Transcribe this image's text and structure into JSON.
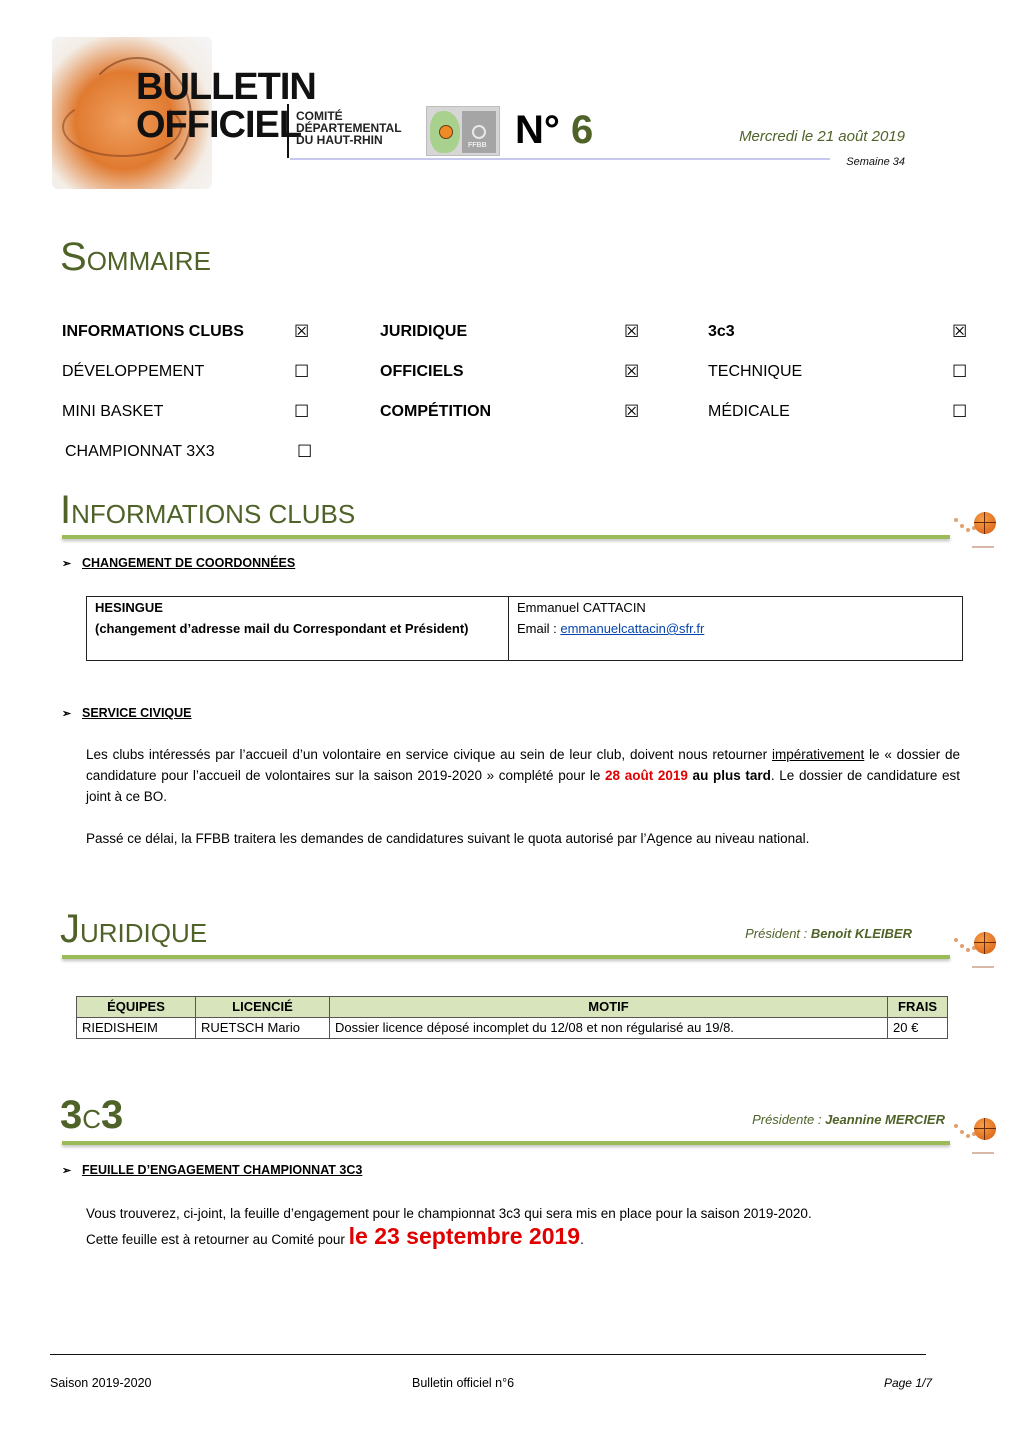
{
  "header": {
    "title_line1": "BULLETIN",
    "title_line2": "OFFICIEL",
    "committee_line1": "COMITÉ",
    "committee_line2": "DÉPARTEMENTAL",
    "committee_line3": "DU HAUT-RHIN",
    "logo_label": "FFBB",
    "issue_prefix": "N°",
    "issue_number": "6",
    "date": "Mercredi le 21 août 2019",
    "week": "Semaine 34"
  },
  "sommaire": {
    "title_cap": "S",
    "title_rest": "OMMAIRE",
    "items": [
      {
        "label": "INFORMATIONS CLUBS",
        "checked": "☒"
      },
      {
        "label": "JURIDIQUE",
        "checked": "☒"
      },
      {
        "label": "3c3",
        "checked": "☒"
      },
      {
        "label": "DÉVELOPPEMENT",
        "checked": "☐"
      },
      {
        "label": "OFFICIELS",
        "checked": "☒"
      },
      {
        "label": "TECHNIQUE",
        "checked": "☐"
      },
      {
        "label": "MINI BASKET",
        "checked": "☐"
      },
      {
        "label": "COMPÉTITION",
        "checked": "☒"
      },
      {
        "label": "MÉDICALE",
        "checked": "☐"
      },
      {
        "label": "CHAMPIONNAT 3X3",
        "checked": "☐"
      }
    ]
  },
  "informations_clubs": {
    "title_cap": "I",
    "title_rest": "NFORMATIONS CLUBS",
    "changement": {
      "heading": "CHANGEMENT DE COORDONNÉES",
      "club": "HESINGUE",
      "note": "(changement d’adresse mail du Correspondant et Président)",
      "person": "Emmanuel CATTACIN",
      "email_label": "Email : ",
      "email": "emmanuelcattacin@sfr.fr"
    },
    "service_civique": {
      "heading": "SERVICE CIVIQUE",
      "p1_a": "Les clubs intéressés par l’accueil d’un volontaire en service civique au sein de leur club, doivent nous retourner ",
      "p1_underline": "impérativement",
      "p1_b": " le « dossier de candidature pour l’accueil de volontaires sur la saison 2019-2020 » complété pour le ",
      "p1_red": "28 août 2019",
      "p1_bold": " au plus tard",
      "p1_c": ". Le dossier de candidature est joint à ce BO.",
      "p2": "Passé ce délai, la FFBB traitera les demandes de candidatures suivant le quota autorisé par l’Agence au niveau national."
    }
  },
  "juridique": {
    "title_cap": "J",
    "title_rest": "URIDIQUE",
    "president_label": "Président : ",
    "president_name": "Benoit KLEIBER",
    "table": {
      "headers": [
        "ÉQUIPES",
        "LICENCIÉ",
        "MOTIF",
        "FRAIS"
      ],
      "rows": [
        [
          "RIEDISHEIM",
          "RUETSCH Mario",
          "Dossier licence déposé incomplet du 12/08 et non régularisé au 19/8.",
          "20 €"
        ]
      ]
    }
  },
  "trois_c_trois": {
    "title_a": "3",
    "title_b": "C",
    "title_c": "3",
    "president_label": "Présidente : ",
    "president_name": "Jeannine MERCIER",
    "heading": "FEUILLE D’ENGAGEMENT CHAMPIONNAT 3C3",
    "p1": "Vous trouverez, ci-joint, la feuille d’engagement pour le championnat 3c3 qui sera mis en place pour la saison 2019-2020.",
    "p2_a": "Cette feuille est à retourner au Comité pour ",
    "p2_red": "le 23 septembre 2019",
    "p2_b": "."
  },
  "footer": {
    "left": "Saison 2019-2020",
    "center": "Bulletin officiel n°6",
    "right": "Page 1/7"
  },
  "colors": {
    "accent_green": "#4f6228",
    "rule_green": "#9bbb59",
    "table_header": "#d7e4bc",
    "highlight_red": "#e00000"
  }
}
